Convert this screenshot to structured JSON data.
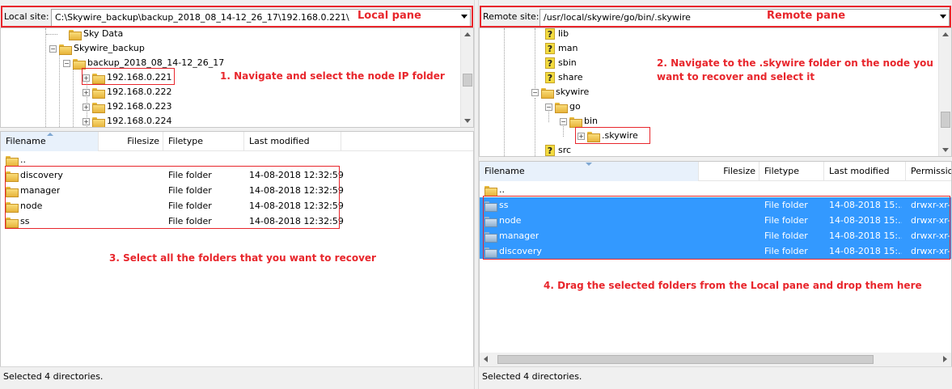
{
  "local": {
    "site_label": "Local site:",
    "site_path": "C:\\Skywire_backup\\backup_2018_08_14-12_26_17\\192.168.0.221\\",
    "pane_title": "Local pane",
    "tree": [
      {
        "label": "Sky Data"
      },
      {
        "label": "Skywire_backup"
      },
      {
        "label": "backup_2018_08_14-12_26_17"
      },
      {
        "label": "192.168.0.221",
        "expander": "+"
      },
      {
        "label": "192.168.0.222",
        "expander": "+"
      },
      {
        "label": "192.168.0.223",
        "expander": "+"
      },
      {
        "label": "192.168.0.224",
        "expander": "+"
      }
    ],
    "columns": [
      "Filename",
      "Filesize",
      "Filetype",
      "Last modified"
    ],
    "rows": [
      {
        "name": "..",
        "type": "",
        "modified": ""
      },
      {
        "name": "discovery",
        "type": "File folder",
        "modified": "14-08-2018 12:32:59"
      },
      {
        "name": "manager",
        "type": "File folder",
        "modified": "14-08-2018 12:32:59"
      },
      {
        "name": "node",
        "type": "File folder",
        "modified": "14-08-2018 12:32:59"
      },
      {
        "name": "ss",
        "type": "File folder",
        "modified": "14-08-2018 12:32:59"
      }
    ],
    "status": "Selected 4 directories."
  },
  "remote": {
    "site_label": "Remote site:",
    "site_path": "/usr/local/skywire/go/bin/.skywire",
    "pane_title": "Remote pane",
    "tree": [
      {
        "label": "lib",
        "icon": "question"
      },
      {
        "label": "man",
        "icon": "question"
      },
      {
        "label": "sbin",
        "icon": "question"
      },
      {
        "label": "share",
        "icon": "question"
      },
      {
        "label": "skywire",
        "icon": "folder"
      },
      {
        "label": "go",
        "icon": "folder"
      },
      {
        "label": "bin",
        "icon": "folder"
      },
      {
        "label": ".skywire",
        "icon": "folder",
        "expander": "+"
      },
      {
        "label": "src",
        "icon": "question"
      }
    ],
    "columns": [
      "Filename",
      "Filesize",
      "Filetype",
      "Last modified",
      "Permissio"
    ],
    "rows": [
      {
        "name": "..",
        "type": "",
        "modified": "",
        "perms": ""
      },
      {
        "name": "ss",
        "type": "File folder",
        "modified": "14-08-2018 15:...",
        "perms": "drwxr-xr-"
      },
      {
        "name": "node",
        "type": "File folder",
        "modified": "14-08-2018 15:...",
        "perms": "drwxr-xr-"
      },
      {
        "name": "manager",
        "type": "File folder",
        "modified": "14-08-2018 15:...",
        "perms": "drwxr-xr-"
      },
      {
        "name": "discovery",
        "type": "File folder",
        "modified": "14-08-2018 15:...",
        "perms": "drwxr-xr-"
      }
    ],
    "status": "Selected 4 directories."
  },
  "annotations": {
    "step1": "1. Navigate and select the node IP folder",
    "step2_line1": "2. Navigate to the .skywire folder on the node you",
    "step2_line2": "want to recover and select it",
    "step3": "3. Select all the folders that you want to recover",
    "step4": "4. Drag the selected folders from the Local pane and drop them here"
  },
  "colors": {
    "annotation": "#e8262c",
    "selection": "#3399ff"
  }
}
